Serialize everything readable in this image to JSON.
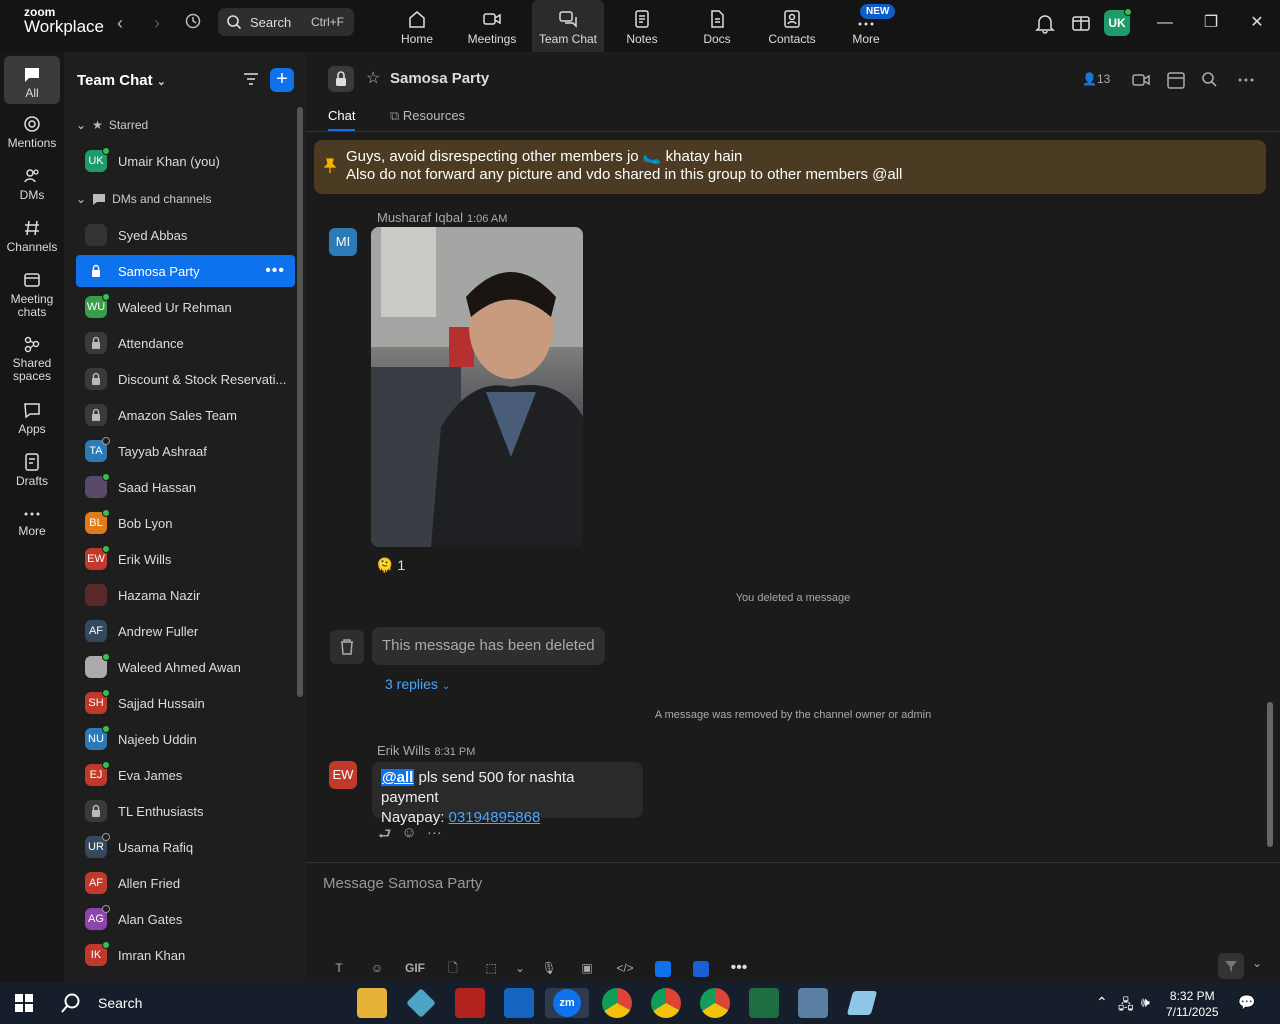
{
  "app": {
    "logo_top": "zoom",
    "logo_bottom": "Workplace"
  },
  "topbar": {
    "search_label": "Search",
    "search_shortcut": "Ctrl+F",
    "tabs": [
      {
        "label": "Home",
        "icon": "home-icon"
      },
      {
        "label": "Meetings",
        "icon": "video-icon"
      },
      {
        "label": "Team Chat",
        "icon": "chat-icon"
      },
      {
        "label": "Notes",
        "icon": "notes-icon"
      },
      {
        "label": "Docs",
        "icon": "docs-icon"
      },
      {
        "label": "Contacts",
        "icon": "contacts-icon"
      },
      {
        "label": "More",
        "icon": "more-icon"
      }
    ],
    "new_badge": "NEW",
    "user_initials": "UK"
  },
  "rail": {
    "items": [
      {
        "label": "All"
      },
      {
        "label": "Mentions"
      },
      {
        "label": "DMs"
      },
      {
        "label": "Channels"
      },
      {
        "label": "Meeting chats"
      },
      {
        "label": "Shared spaces"
      },
      {
        "label": "Apps"
      },
      {
        "label": "Drafts"
      },
      {
        "label": "More"
      }
    ]
  },
  "sidebar": {
    "title": "Team Chat",
    "starred_label": "Starred",
    "dms_label": "DMs and channels",
    "starred_items": [
      {
        "name": "Umair Khan (you)",
        "initials": "UK",
        "color": "#1d9c6a",
        "status": "online"
      }
    ],
    "items": [
      {
        "name": "Syed Abbas",
        "initials": "",
        "color": "#333",
        "status": "none"
      },
      {
        "name": "Samosa Party",
        "initials": "",
        "color": "#0e72ed",
        "status": "lock",
        "active": true
      },
      {
        "name": "Waleed Ur Rehman",
        "initials": "WU",
        "color": "#3a9d4a",
        "status": "online"
      },
      {
        "name": "Attendance",
        "initials": "",
        "color": "#3a3a3a",
        "status": "lock"
      },
      {
        "name": "Discount & Stock Reservati...",
        "initials": "",
        "color": "#3a3a3a",
        "status": "lock"
      },
      {
        "name": "Amazon Sales Team",
        "initials": "",
        "color": "#3a3a3a",
        "status": "lock"
      },
      {
        "name": "Tayyab Ashraaf",
        "initials": "TA",
        "color": "#2c7bb6",
        "status": "away"
      },
      {
        "name": "Saad Hassan",
        "initials": "",
        "color": "#5a4a6a",
        "status": "online"
      },
      {
        "name": "Bob Lyon",
        "initials": "BL",
        "color": "#e07b1a",
        "status": "online"
      },
      {
        "name": "Erik Wills",
        "initials": "EW",
        "color": "#c0392b",
        "status": "online"
      },
      {
        "name": "Hazama Nazir",
        "initials": "",
        "color": "#5a2a2a",
        "status": "none"
      },
      {
        "name": "Andrew Fuller",
        "initials": "AF",
        "color": "#34495e",
        "status": "none"
      },
      {
        "name": "Waleed Ahmed Awan",
        "initials": "",
        "color": "#aaa",
        "status": "online"
      },
      {
        "name": "Sajjad Hussain",
        "initials": "SH",
        "color": "#c0392b",
        "status": "online"
      },
      {
        "name": "Najeeb Uddin",
        "initials": "NU",
        "color": "#2c7bb6",
        "status": "online"
      },
      {
        "name": "Eva James",
        "initials": "EJ",
        "color": "#c0392b",
        "status": "online"
      },
      {
        "name": "TL Enthusiasts",
        "initials": "",
        "color": "#3a3a3a",
        "status": "lock"
      },
      {
        "name": "Usama Rafiq",
        "initials": "UR",
        "color": "#34495e",
        "status": "away"
      },
      {
        "name": "Allen Fried",
        "initials": "AF",
        "color": "#c0392b",
        "status": "none"
      },
      {
        "name": "Alan Gates",
        "initials": "AG",
        "color": "#8e44ad",
        "status": "away"
      },
      {
        "name": "Imran Khan",
        "initials": "IK",
        "color": "#c0392b",
        "status": "online"
      }
    ]
  },
  "channel": {
    "name": "Samosa Party",
    "member_count": "13",
    "tab_chat": "Chat",
    "tab_resources": "Resources"
  },
  "pinned": {
    "line1": "Guys, avoid disrespecting other members jo 🥿 khatay hain",
    "line2": "Also do not forward any picture and vdo shared in this group to other members @all"
  },
  "messages": {
    "m1_initials": "MI",
    "m1_sender": "Musharaf Iqbal",
    "m1_time": "1:06 AM",
    "m1_reaction_emoji": "🫠",
    "m1_reaction_count": "1",
    "sys_deleted": "You deleted a message",
    "deleted_text": "This message has been deleted",
    "replies": "3 replies",
    "sys_removed": "A message was removed by the channel owner or admin",
    "m2_initials": "EW",
    "m2_sender": "Erik Wills",
    "m2_time": "8:31 PM",
    "m2_mention": "@all",
    "m2_text": " pls send 500 for nashta payment",
    "m2_line2_label": "Nayapay: ",
    "m2_link": "03194895868"
  },
  "compose": {
    "placeholder": "Message Samosa Party",
    "gif_label": "GIF"
  },
  "taskbar": {
    "search_label": "Search",
    "time": "8:32 PM",
    "date": "7/11/2025"
  },
  "colors": {
    "accent": "#0e72ed",
    "pinned_bg": "#4a3b22",
    "online": "#31c14c"
  }
}
